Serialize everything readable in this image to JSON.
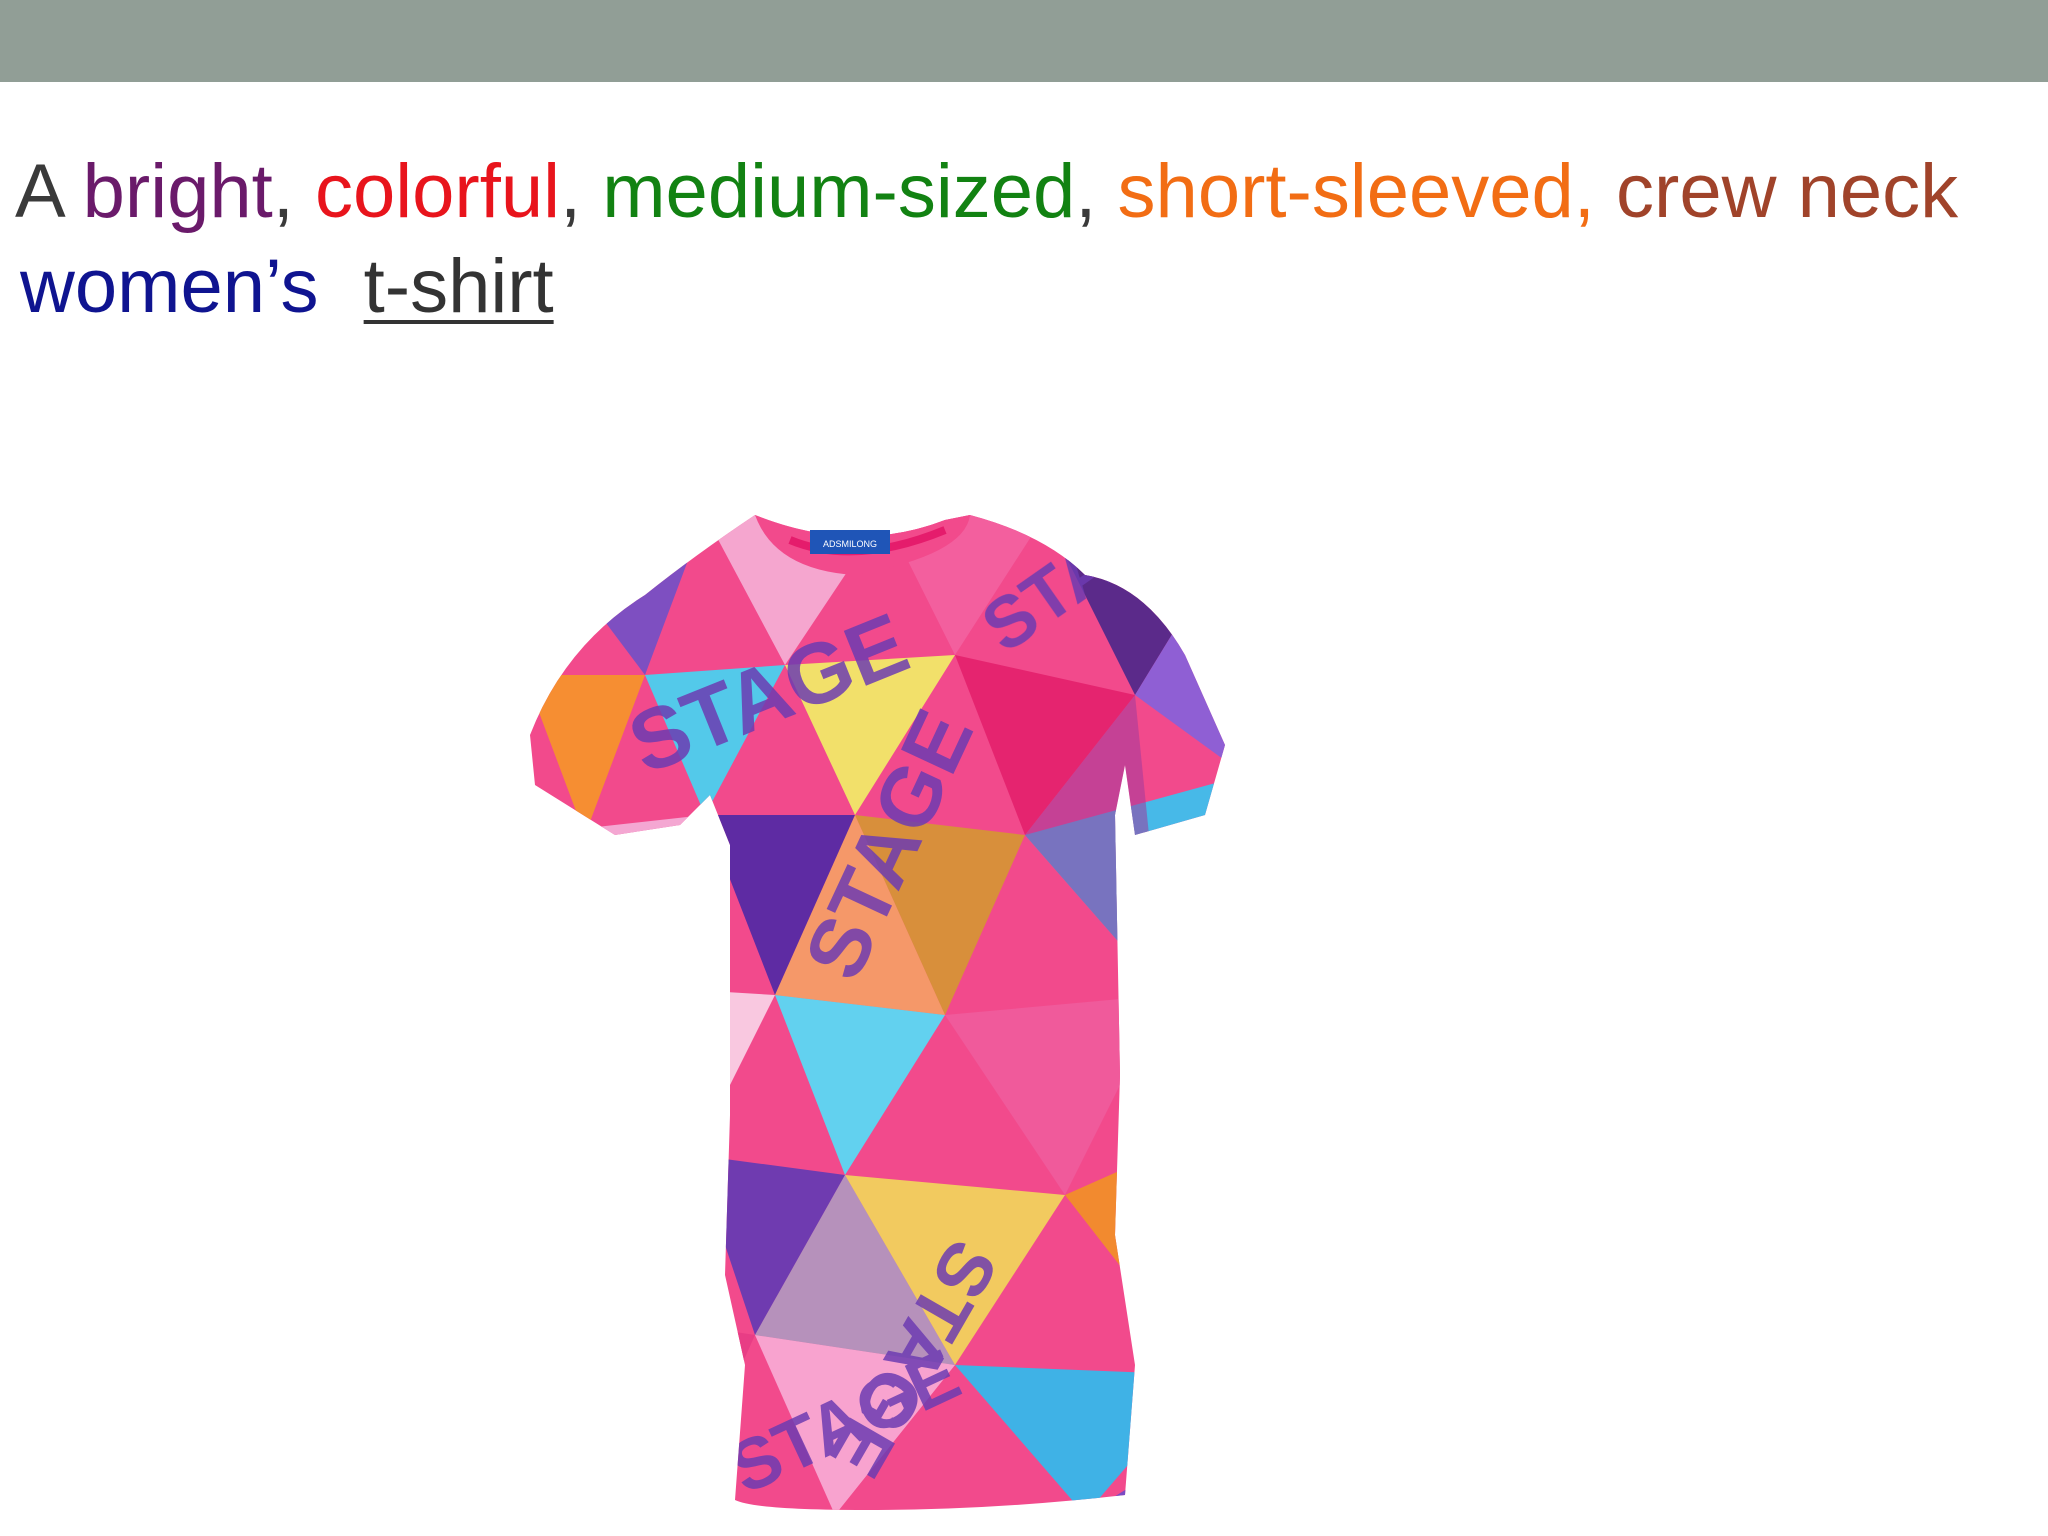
{
  "colors": {
    "top_bar": "#919e96",
    "article": "#3a3a3a",
    "bright": "#6a1a6a",
    "colorful": "#e8141c",
    "medium": "#128212",
    "short": "#f26d14",
    "crew": "#a0432a",
    "womens": "#0f1490",
    "noun": "#333333",
    "punct": "#3a3a3a"
  },
  "caption": {
    "article": "A",
    "bright": "bright",
    "colorful": "colorful",
    "medium": "medium-sized",
    "short": "short-sleeved,",
    "crew": "crew neck",
    "womens": "women’s",
    "noun": "t-shirt",
    "comma": ","
  },
  "image": {
    "subject": "t-shirt",
    "tag_brand": "ADSMILONG",
    "print_word": "STAGE"
  }
}
